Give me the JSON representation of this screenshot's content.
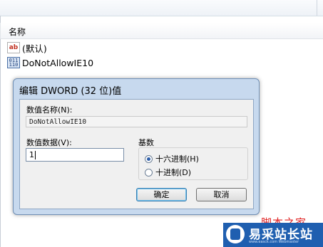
{
  "header": {
    "name_column": "名称"
  },
  "values": [
    {
      "icon": "string-value-icon",
      "name": "(默认)"
    },
    {
      "icon": "binary-value-icon",
      "name": "DoNotAllowIE10"
    }
  ],
  "dialog": {
    "title": "编辑 DWORD (32 位)值",
    "value_name_label": "数值名称(N):",
    "value_name": "DoNotAllowIE10",
    "value_data_label": "数值数据(V):",
    "value_data": "1",
    "base_label": "基数",
    "radix_options": [
      {
        "label": "十六进制(H)",
        "selected": true
      },
      {
        "label": "十进制(D)",
        "selected": false
      }
    ],
    "ok_label": "确定",
    "cancel_label": "取消"
  },
  "watermark": {
    "red_text": "脚本之家",
    "site_name": "易采站长站",
    "tagline": "www.easck.com Webmaster"
  },
  "colors": {
    "dialog_frame": "#c7d9ee",
    "dialog_body": "#f0f0f0",
    "watermark_red": "#e02020",
    "watermark_blue": "#1f5fb0"
  }
}
